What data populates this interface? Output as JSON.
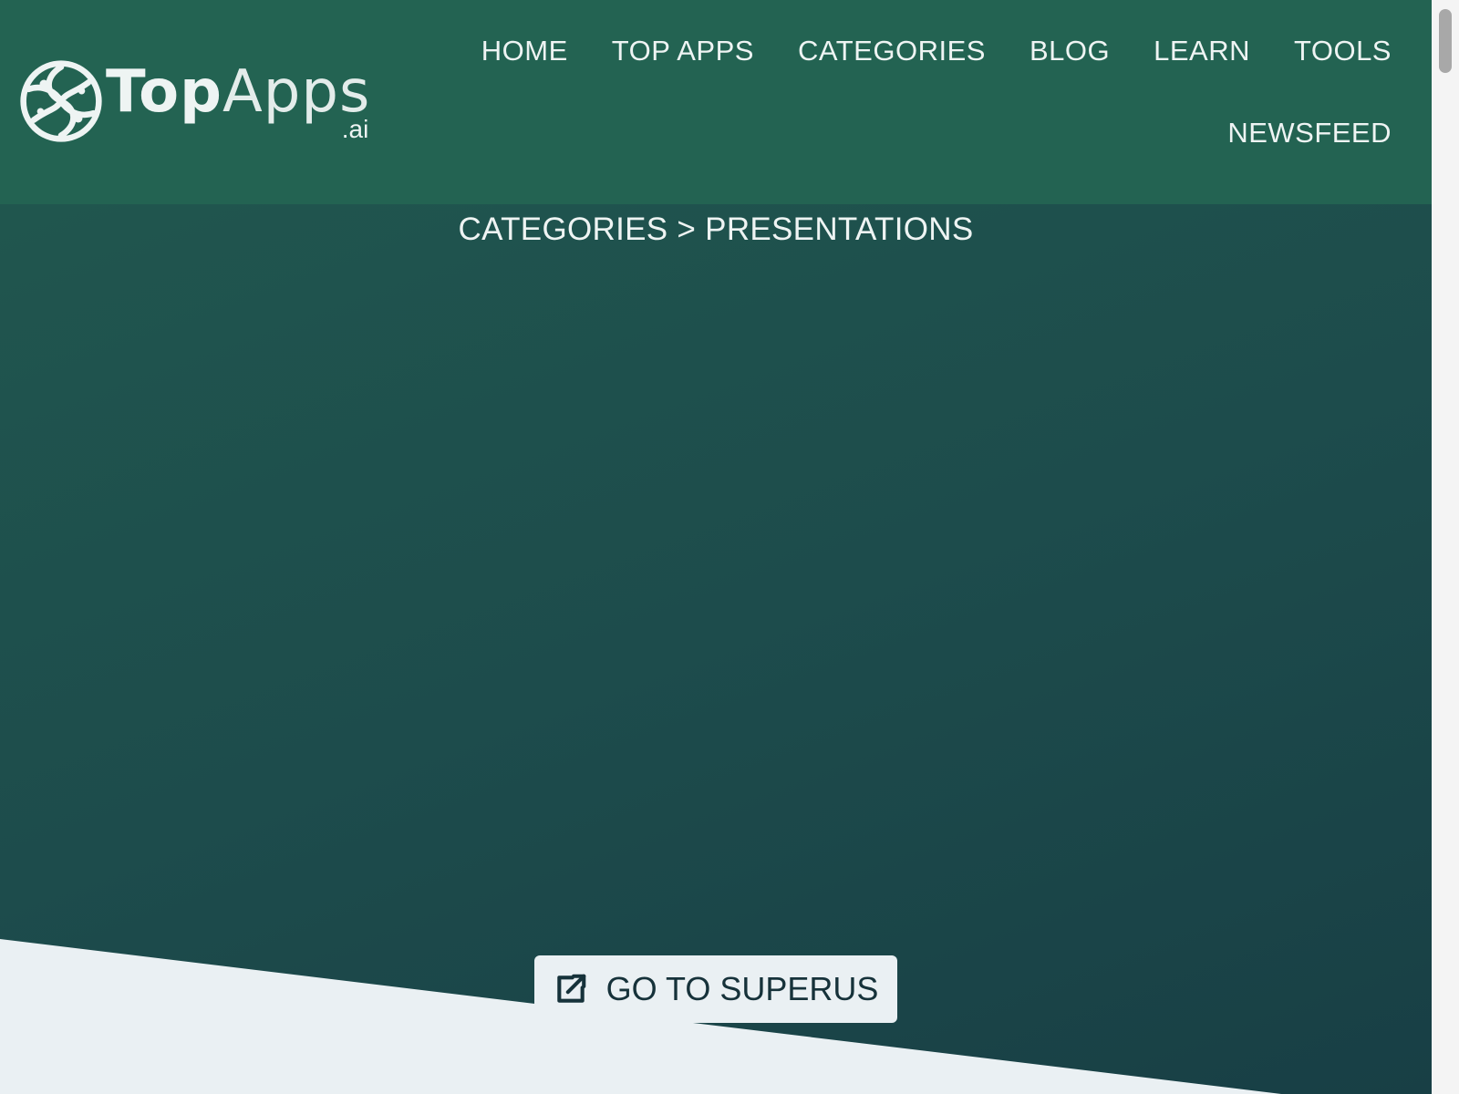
{
  "logo": {
    "bold": "Top",
    "light": "Apps",
    "suffix": ".ai"
  },
  "nav": {
    "items": [
      {
        "label": "HOME"
      },
      {
        "label": "TOP APPS"
      },
      {
        "label": "CATEGORIES"
      },
      {
        "label": "BLOG"
      },
      {
        "label": "LEARN"
      },
      {
        "label": "TOOLS"
      },
      {
        "label": "NEWSFEED"
      }
    ]
  },
  "breadcrumb": "CATEGORIES > PRESENTATIONS",
  "cta": {
    "label": "GO TO SUPERUS",
    "icon": "external-link-icon"
  },
  "colors": {
    "header": "#236352",
    "hero_top": "#21594f",
    "hero_bottom": "#183f45",
    "light_bg": "#eaf0f3",
    "button_text": "#16323a"
  }
}
